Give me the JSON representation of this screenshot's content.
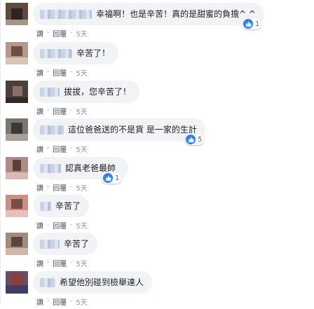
{
  "actions": {
    "like": "讚",
    "reply": "回覆",
    "sep": "·"
  },
  "comments": [
    {
      "text": "幸福啊！也是辛苦！真的是甜蜜的負擔^ ^",
      "time": "5天",
      "likes": "1"
    },
    {
      "text": "辛苦了！",
      "time": "5天",
      "likes": ""
    },
    {
      "text": "拔拔，您辛苦了！",
      "time": "5天",
      "likes": ""
    },
    {
      "text": "這位爸爸送的不是貨 是一家的生計",
      "time": "5天",
      "likes": "5"
    },
    {
      "text": "認真老爸最帥",
      "time": "5天",
      "likes": "1"
    },
    {
      "text": "辛苦了",
      "time": "5天",
      "likes": ""
    },
    {
      "text": "辛苦了",
      "time": "5天",
      "likes": ""
    },
    {
      "text": "希望他別碰到檢舉達人",
      "time": "5天",
      "likes": ""
    }
  ],
  "colors": {
    "like_blue": "#2e81f4",
    "bubble_bg": "#f2f3f5",
    "name_blur": "#c9d3e6"
  },
  "icons": {
    "like_reaction": "thumbs-up-icon"
  }
}
